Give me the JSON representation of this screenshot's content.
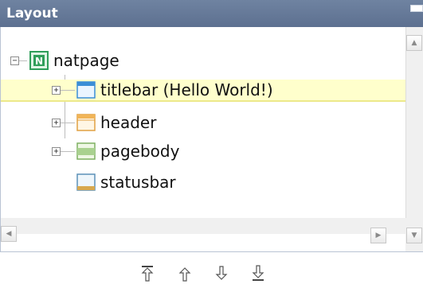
{
  "panel": {
    "title": "Layout"
  },
  "tree": {
    "root": {
      "label": "natpage",
      "icon_letter": "N"
    },
    "children": [
      {
        "label": "titlebar (Hello World!)",
        "expandable": true,
        "selected": true
      },
      {
        "label": "header",
        "expandable": true,
        "selected": false
      },
      {
        "label": "pagebody",
        "expandable": true,
        "selected": false
      },
      {
        "label": "statusbar",
        "expandable": false,
        "selected": false
      }
    ]
  },
  "toolbar": {
    "icons": [
      "move-top-icon",
      "move-up-icon",
      "move-down-icon",
      "move-bottom-icon"
    ]
  },
  "colors": {
    "titlebar_bg": "#6f83a1",
    "selection_bg": "#ffffcc",
    "root_icon": "#2f9e5a"
  }
}
